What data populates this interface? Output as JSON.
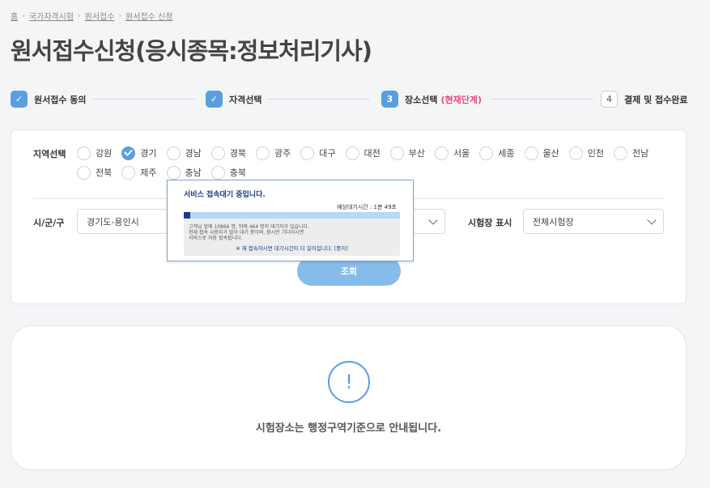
{
  "breadcrumb": [
    "홈",
    "국가자격시험",
    "원서접수",
    "원서접수 신청"
  ],
  "page_title": "원서접수신청(응시종목:정보처리기사)",
  "steps": [
    {
      "num": "",
      "label": "원서접수 동의",
      "state": "done"
    },
    {
      "num": "",
      "label": "자격선택",
      "state": "done"
    },
    {
      "num": "3",
      "label": "장소선택",
      "tag": "(현재단계)",
      "state": "current"
    },
    {
      "num": "4",
      "label": "결제 및 접수완료",
      "state": "todo"
    }
  ],
  "filter": {
    "region_label": "지역선택",
    "regions": [
      {
        "name": "강원",
        "checked": false
      },
      {
        "name": "경기",
        "checked": true
      },
      {
        "name": "경남",
        "checked": false
      },
      {
        "name": "경북",
        "checked": false
      },
      {
        "name": "광주",
        "checked": false
      },
      {
        "name": "대구",
        "checked": false
      },
      {
        "name": "대전",
        "checked": false
      },
      {
        "name": "부산",
        "checked": false
      },
      {
        "name": "서울",
        "checked": false
      },
      {
        "name": "세종",
        "checked": false
      },
      {
        "name": "울산",
        "checked": false
      },
      {
        "name": "인천",
        "checked": false
      },
      {
        "name": "전남",
        "checked": false
      },
      {
        "name": "전북",
        "checked": false
      },
      {
        "name": "제주",
        "checked": false
      },
      {
        "name": "충남",
        "checked": false
      },
      {
        "name": "충북",
        "checked": false
      }
    ],
    "city_label": "시/군/구",
    "city_value": "경기도-용인시",
    "venue_label": "시험장 표시",
    "venue_value": "전체시험장",
    "search_button": "조회"
  },
  "info": {
    "icon": "!",
    "message": "시험장소는 행정구역기준으로 안내됩니다."
  },
  "queue_modal": {
    "title": "서비스 접속대기 중입니다.",
    "eta": "예상대기시간 : 1분 49초",
    "progress": 0.03,
    "line1": "고객님 앞에 10866 명, 뒤에 464 명의 대기자가 있습니다.",
    "line2": "현재 접속 사용자가 많아 대기 중이며, 잠시만 기다리시면",
    "line3": "서비스로 자동 접속됩니다.",
    "note": "※ 재 접속하시면 대기시간이 더 길어집니다. [중지]"
  },
  "colors": {
    "accent": "#5b9ee0",
    "current_tag": "#e24b7a",
    "modal_navy": "#1b3a8c",
    "button_blue": "#86bce9"
  }
}
